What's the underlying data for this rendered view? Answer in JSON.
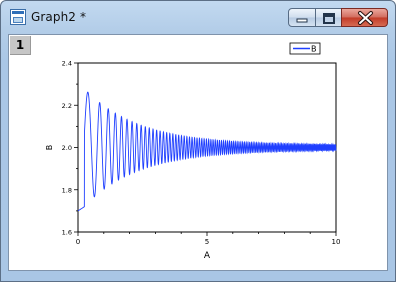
{
  "window": {
    "title": "Graph2 *",
    "layer_tab": "1",
    "icon": "origin-graph-icon"
  },
  "controls": {
    "minimize_icon": "minimize-icon",
    "maximize_icon": "maximize-icon",
    "close_icon": "close-icon"
  },
  "chart_data": {
    "type": "line",
    "title": "",
    "xlabel": "A",
    "ylabel": "B",
    "xlim": [
      0,
      10
    ],
    "ylim": [
      1.6,
      2.4
    ],
    "x_ticks": [
      "0",
      "5",
      "10"
    ],
    "y_ticks": [
      "1.6",
      "1.8",
      "2.0",
      "2.2",
      "2.4"
    ],
    "legend": {
      "placement": "top-right",
      "entries": [
        "B"
      ]
    },
    "grid": false,
    "series": [
      {
        "name": "B",
        "color": "#1f3fff",
        "description_of_shape": "damped oscillation around 2.0",
        "x": [
          0,
          0.1,
          0.2,
          0.3,
          0.4,
          0.5,
          0.6,
          0.7,
          0.8,
          0.9,
          1.0,
          1.1,
          1.2,
          1.3,
          1.4,
          1.5,
          1.6,
          1.7,
          1.8,
          1.9,
          2.0,
          2.5,
          3.0,
          3.5,
          4.0,
          5.0,
          6.0,
          7.0,
          8.0,
          9.0,
          10.0
        ],
        "y": [
          1.7,
          1.71,
          1.8,
          2.0,
          2.2,
          2.28,
          2.3,
          2.1,
          1.88,
          1.75,
          1.85,
          2.18,
          2.24,
          1.95,
          1.78,
          2.15,
          1.8,
          2.12,
          1.82,
          2.12,
          1.85,
          2.1,
          1.9,
          2.07,
          1.93,
          2.04,
          1.97,
          2.02,
          1.99,
          2.01,
          2.0
        ]
      }
    ]
  }
}
